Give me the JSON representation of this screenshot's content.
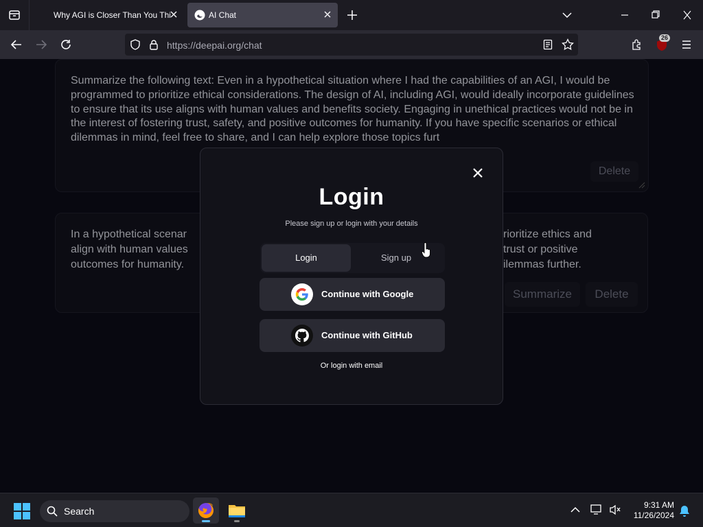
{
  "browser": {
    "tabs": [
      {
        "title": "Why AGI is Closer Than You Thi",
        "active": false
      },
      {
        "title": "AI Chat",
        "active": true
      }
    ],
    "url_domain": "https://deepai.org",
    "url_path": "/chat",
    "extension_badge": "26"
  },
  "chat": {
    "message1": {
      "text": "Summarize the following text: Even in a hypothetical situation where I had the capabilities of an AGI, I would be programmed to prioritize ethical considerations. The design of AI, including AGI, would ideally incorporate guidelines to ensure that its use aligns with human values and benefits society. Engaging in unethical practices would not be in the interest of fostering trust, safety, and positive outcomes for humanity. If you have specific scenarios or ethical dilemmas in mind, feel free to share, and I can help explore those topics furt",
      "delete_label": "Delete"
    },
    "message2": {
      "line1_left": "In a hypothetical scenar",
      "line1_right": "rioritize ethics and",
      "line2_left": "align with human values",
      "line2_right": "trust or positive",
      "line3_left": "outcomes for humanity.",
      "line3_right": "ilemmas further.",
      "summarize_label": "Summarize",
      "delete_label": "Delete"
    }
  },
  "login_modal": {
    "title": "Login",
    "subtitle": "Please sign up or login with your details",
    "tab_login": "Login",
    "tab_signup": "Sign up",
    "google_label": "Continue with Google",
    "github_label": "Continue with GitHub",
    "email_link": "Or login with email"
  },
  "taskbar": {
    "search_label": "Search",
    "time": "9:31 AM",
    "date": "11/26/2024"
  },
  "colors": {
    "page_bg": "#0b0b16",
    "modal_bg": "#121219",
    "button_bg": "#2a2a33",
    "accent_blue": "#60c0ff"
  }
}
